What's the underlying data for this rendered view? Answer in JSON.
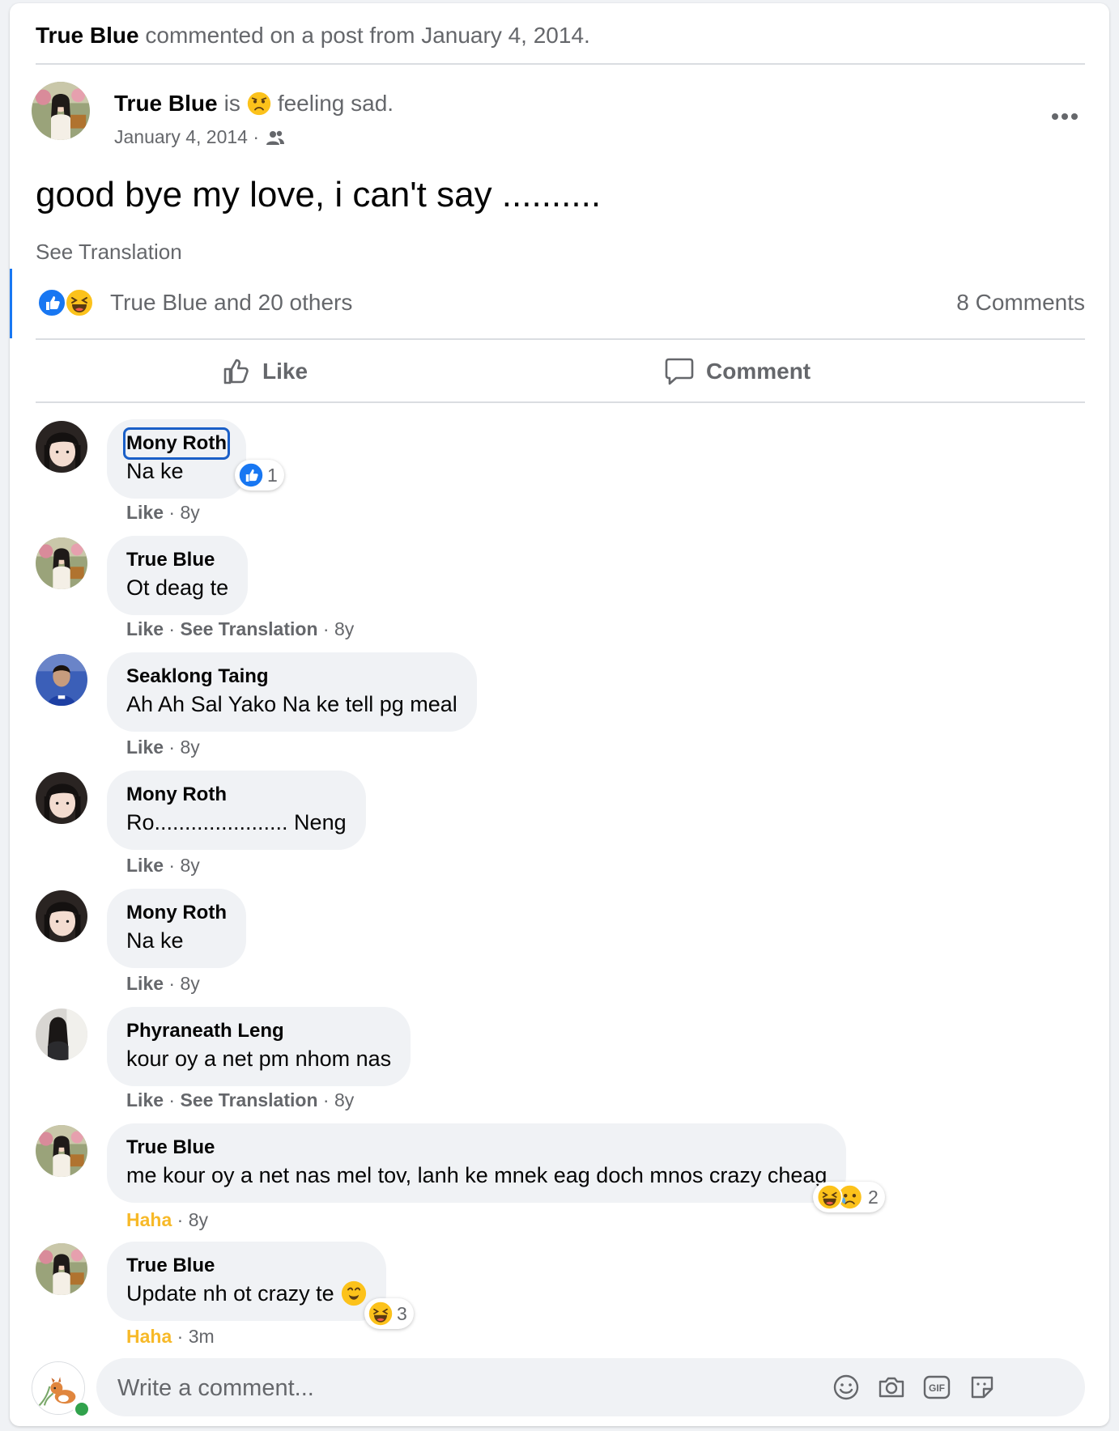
{
  "activity": {
    "actor": "True Blue",
    "text": "commented on a post from January 4, 2014."
  },
  "post": {
    "author": "True Blue",
    "is": "is",
    "feeling": "feeling sad.",
    "date": "January 4, 2014 ·",
    "text": "good bye my love, i can't say ..........",
    "see_translation": "See Translation",
    "reactions_text": "True Blue and 20 others",
    "comments_count": "8 Comments"
  },
  "actions": {
    "like": "Like",
    "comment": "Comment"
  },
  "comments": [
    {
      "name": "Mony Roth",
      "text": "Na ke",
      "meta": [
        {
          "t": "Like",
          "k": "act"
        },
        {
          "t": " · 8y",
          "k": "plain"
        }
      ],
      "reaction_count": "1"
    },
    {
      "name": "True Blue",
      "text": "Ot deag te",
      "meta": [
        {
          "t": "Like",
          "k": "act"
        },
        {
          "t": " · ",
          "k": "plain"
        },
        {
          "t": "See Translation",
          "k": "act"
        },
        {
          "t": " · 8y",
          "k": "plain"
        }
      ]
    },
    {
      "name": "Seaklong Taing",
      "text": "Ah Ah Sal Yako Na ke tell pg meal",
      "meta": [
        {
          "t": "Like",
          "k": "act"
        },
        {
          "t": " · 8y",
          "k": "plain"
        }
      ]
    },
    {
      "name": "Mony Roth",
      "text": "Ro...................... Neng",
      "meta": [
        {
          "t": "Like",
          "k": "act"
        },
        {
          "t": " · 8y",
          "k": "plain"
        }
      ]
    },
    {
      "name": "Mony Roth",
      "text": "Na ke",
      "meta": [
        {
          "t": "Like",
          "k": "act"
        },
        {
          "t": " · 8y",
          "k": "plain"
        }
      ]
    },
    {
      "name": "Phyraneath Leng",
      "text": "kour oy a net pm nhom nas",
      "meta": [
        {
          "t": "Like",
          "k": "act"
        },
        {
          "t": " · ",
          "k": "plain"
        },
        {
          "t": "See Translation",
          "k": "act"
        },
        {
          "t": " · 8y",
          "k": "plain"
        }
      ]
    },
    {
      "name": "True Blue",
      "text": "me kour oy a net nas mel tov, lanh ke mnek eag doch mnos crazy cheag",
      "meta": [
        {
          "t": "Haha",
          "k": "haha"
        },
        {
          "t": " · 8y",
          "k": "plain"
        }
      ],
      "reaction_count": "2"
    },
    {
      "name": "True Blue",
      "text": "Update nh ot crazy te",
      "meta": [
        {
          "t": "Haha",
          "k": "haha"
        },
        {
          "t": " · 3m",
          "k": "plain"
        }
      ],
      "reaction_count": "3"
    }
  ],
  "composer": {
    "placeholder": "Write a comment..."
  },
  "icons": {
    "more": "more-icon",
    "audience": "friends-icon",
    "like": "thumbs-up-icon",
    "comment": "comment-icon",
    "emoji": "emoji-icon",
    "camera": "camera-icon",
    "gif": "gif-icon",
    "sticker": "sticker-icon"
  },
  "colors": {
    "accent": "#1877f2",
    "haha": "#f7b928",
    "muted": "#65676b",
    "bubble": "#f0f2f5"
  }
}
